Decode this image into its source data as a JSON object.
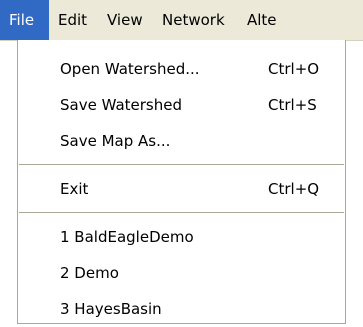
{
  "menubar": {
    "items": [
      {
        "label": "File"
      },
      {
        "label": "Edit"
      },
      {
        "label": "View"
      },
      {
        "label": "Network"
      },
      {
        "label": "Alte"
      }
    ],
    "active_index": 0,
    "highlight_color": "#316ac5"
  },
  "file_menu": {
    "groups": [
      {
        "items": [
          {
            "label": "Open Watershed...",
            "shortcut": "Ctrl+O"
          },
          {
            "label": "Save Watershed",
            "shortcut": "Ctrl+S"
          },
          {
            "label": "Save Map As...",
            "shortcut": ""
          }
        ]
      },
      {
        "items": [
          {
            "label": "Exit",
            "shortcut": "Ctrl+Q"
          }
        ]
      },
      {
        "items": [
          {
            "label": "1 BaldEagleDemo",
            "shortcut": ""
          },
          {
            "label": "2 Demo",
            "shortcut": ""
          },
          {
            "label": "3 HayesBasin",
            "shortcut": ""
          }
        ]
      }
    ]
  }
}
